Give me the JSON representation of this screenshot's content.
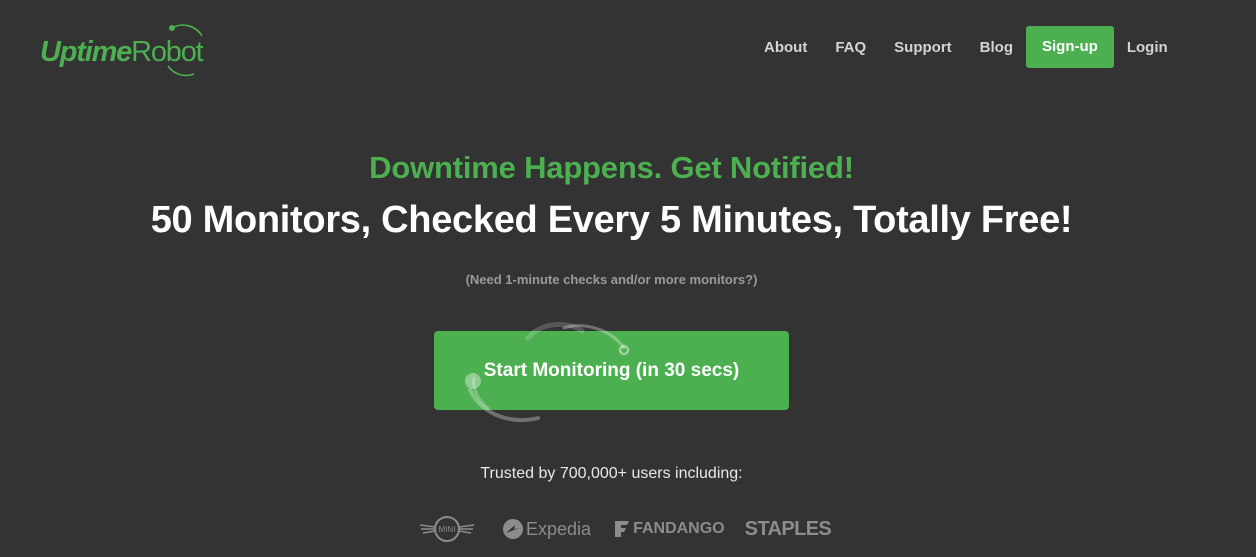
{
  "brand": {
    "logo_part1": "Uptime",
    "logo_part2": "Robot"
  },
  "nav": {
    "items": [
      "About",
      "FAQ",
      "Support",
      "Blog"
    ],
    "signup": "Sign-up",
    "login": "Login"
  },
  "hero": {
    "tagline": "Downtime Happens. Get Notified!",
    "headline": "50 Monitors, Checked Every 5 Minutes, Totally Free!",
    "subnote": "(Need 1-minute checks and/or more monitors?)",
    "cta": "Start Monitoring (in 30 secs)"
  },
  "trust": {
    "text": "Trusted by 700,000+ users including:",
    "brands": [
      "MINI",
      "Expedia",
      "FANDANGO",
      "STAPLES"
    ]
  },
  "colors": {
    "background": "#333333",
    "accent": "#4caf50",
    "nav_text": "#d4d4d4"
  }
}
